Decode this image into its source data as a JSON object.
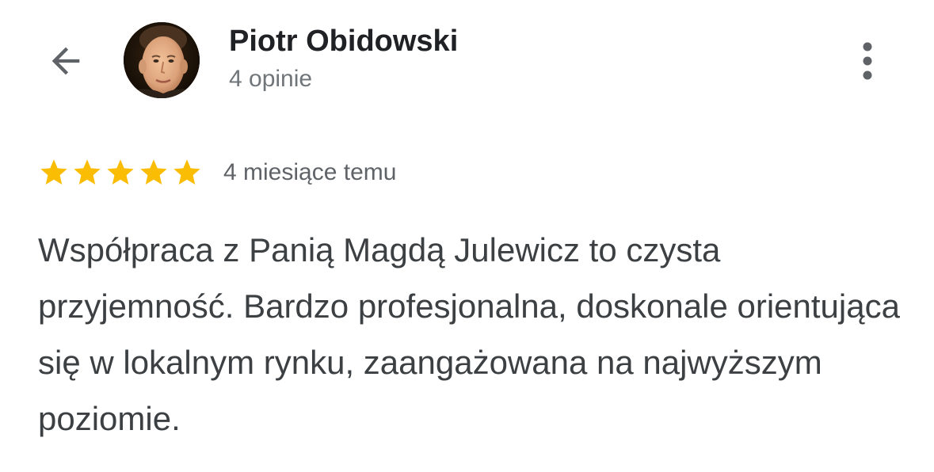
{
  "header": {
    "back_icon": "arrow-back-icon",
    "author_name": "Piotr Obidowski",
    "review_count": "4 opinie",
    "more_icon": "more-vert-icon"
  },
  "review": {
    "rating": 5,
    "rating_max": 5,
    "star_color": "#fbbc04",
    "time": "4 miesiące temu",
    "text": "Współpraca z Panią Magdą Julewicz to czysta przyjemność. Bardzo profesjonalna, doskonale orientująca się w lokalnym rynku, zaangażowana na najwyższym poziomie."
  }
}
